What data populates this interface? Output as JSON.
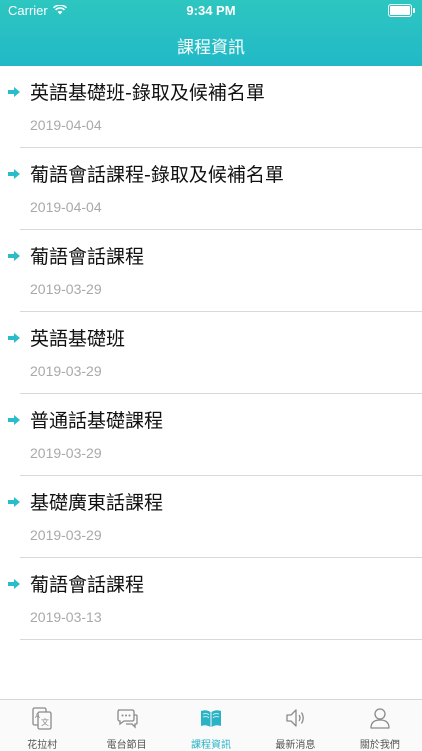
{
  "status_bar": {
    "carrier": "Carrier",
    "time": "9:34 PM"
  },
  "header": {
    "title": "課程資訊"
  },
  "courses": [
    {
      "title": "英語基礎班-錄取及候補名單",
      "date": "2019-04-04"
    },
    {
      "title": "葡語會話課程-錄取及候補名單",
      "date": "2019-04-04"
    },
    {
      "title": "葡語會話課程",
      "date": "2019-03-29"
    },
    {
      "title": "英語基礎班",
      "date": "2019-03-29"
    },
    {
      "title": "普通話基礎課程",
      "date": "2019-03-29"
    },
    {
      "title": "基礎廣東話課程",
      "date": "2019-03-29"
    },
    {
      "title": "葡語會話課程",
      "date": "2019-03-13"
    }
  ],
  "tabbar": {
    "active": "course-info",
    "items": [
      {
        "label": "花拉村",
        "icon": "language-card-icon"
      },
      {
        "label": "電台節目",
        "icon": "chat-bubbles-icon"
      },
      {
        "label": "課程資訊",
        "icon": "book-icon"
      },
      {
        "label": "最新消息",
        "icon": "speaker-icon"
      },
      {
        "label": "關於我們",
        "icon": "person-icon"
      }
    ]
  },
  "colors": {
    "accent": "#2ab3c4",
    "header_top": "#2ec6c0",
    "arrow": "#2bbccb",
    "date": "#a9a9a9"
  }
}
